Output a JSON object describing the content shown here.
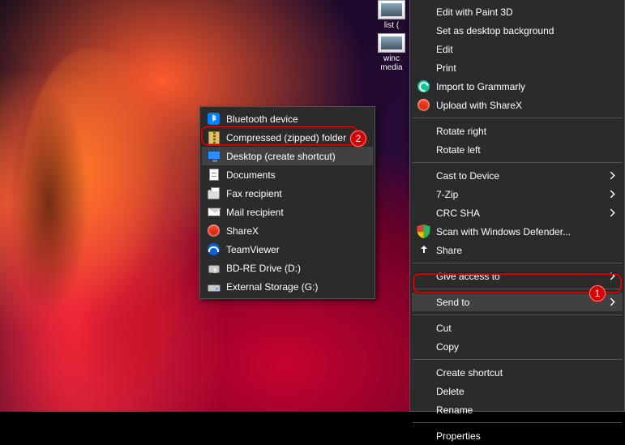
{
  "desktop": {
    "icons": [
      {
        "label": "list ("
      },
      {
        "label": "winc media"
      }
    ]
  },
  "context_menu": {
    "items_group_1": [
      {
        "label": "Edit with Paint 3D"
      },
      {
        "label": "Set as desktop background"
      },
      {
        "label": "Edit"
      },
      {
        "label": "Print"
      },
      {
        "label": "Import to Grammarly",
        "icon": "grammarly-icon"
      },
      {
        "label": "Upload with ShareX",
        "icon": "sharex-icon"
      }
    ],
    "items_group_2": [
      {
        "label": "Rotate right"
      },
      {
        "label": "Rotate left"
      }
    ],
    "items_group_3": [
      {
        "label": "Cast to Device",
        "submenu": true
      },
      {
        "label": "7-Zip",
        "submenu": true
      },
      {
        "label": "CRC SHA",
        "submenu": true
      },
      {
        "label": "Scan with Windows Defender...",
        "icon": "shield-icon"
      },
      {
        "label": "Share",
        "icon": "share-icon"
      }
    ],
    "items_group_4": [
      {
        "label": "Give access to",
        "submenu": true
      }
    ],
    "items_group_5": [
      {
        "label": "Send to",
        "submenu": true,
        "highlighted": true,
        "badge": "1"
      }
    ],
    "items_group_6": [
      {
        "label": "Cut"
      },
      {
        "label": "Copy"
      }
    ],
    "items_group_7": [
      {
        "label": "Create shortcut"
      },
      {
        "label": "Delete"
      },
      {
        "label": "Rename"
      }
    ],
    "items_group_8": [
      {
        "label": "Properties"
      }
    ]
  },
  "sendto_submenu": {
    "items": [
      {
        "label": "Bluetooth device",
        "icon": "bluetooth-icon"
      },
      {
        "label": "Compressed (zipped) folder",
        "icon": "zip-icon",
        "highlighted": true,
        "badge": "2"
      },
      {
        "label": "Desktop (create shortcut)",
        "icon": "monitor-icon",
        "hover": true
      },
      {
        "label": "Documents",
        "icon": "document-icon"
      },
      {
        "label": "Fax recipient",
        "icon": "fax-icon"
      },
      {
        "label": "Mail recipient",
        "icon": "mail-icon"
      },
      {
        "label": "ShareX",
        "icon": "sharex-icon"
      },
      {
        "label": "TeamViewer",
        "icon": "teamviewer-icon"
      },
      {
        "label": "BD-RE Drive (D:)",
        "icon": "disc-drive-icon"
      },
      {
        "label": "External Storage (G:)",
        "icon": "external-drive-icon"
      }
    ]
  },
  "annotations": {
    "sendto_badge": "1",
    "zipped_badge": "2"
  }
}
